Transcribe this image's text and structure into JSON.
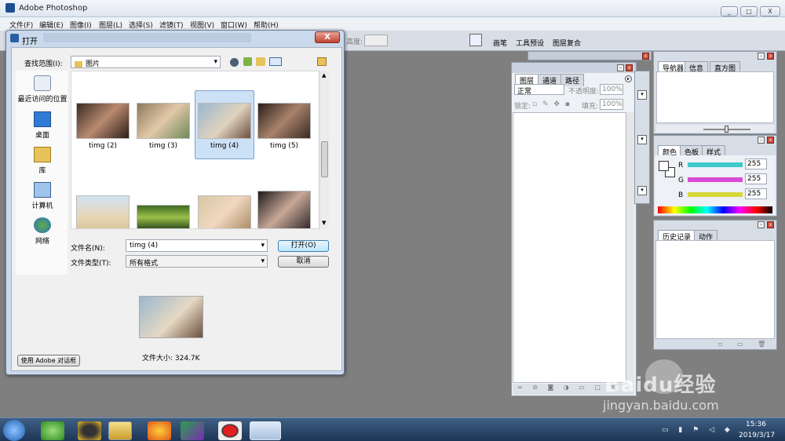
{
  "app": {
    "title": "Adobe Photoshop"
  },
  "window_controls": {
    "minimize": "_",
    "maximize": "□",
    "close": "X"
  },
  "menu": [
    "文件(F)",
    "编辑(E)",
    "图像(I)",
    "图层(L)",
    "选择(S)",
    "滤镜(T)",
    "视图(V)",
    "窗口(W)",
    "帮助(H)"
  ],
  "optionbar": {
    "height_label": "高度:",
    "tabs": [
      "画笔",
      "工具预设",
      "图层复合"
    ]
  },
  "dialog": {
    "title": "打开",
    "close": "X",
    "look_in_label": "查找范围(I):",
    "look_in_value": "图片",
    "places": [
      "最近访问的位置",
      "桌面",
      "库",
      "计算机",
      "网络"
    ],
    "files": [
      "timg (2)",
      "timg (3)",
      "timg (4)",
      "timg (5)"
    ],
    "selected_file": "timg (4)",
    "filename_label": "文件名(N):",
    "filename_value": "timg (4)",
    "filetype_label": "文件类型(T):",
    "filetype_value": "所有格式",
    "open_button": "打开(O)",
    "cancel_button": "取消",
    "file_size": "文件大小: 324.7K",
    "adobe_dialog_button": "使用 Adobe 对话框"
  },
  "layers_panel": {
    "tabs": [
      "图层",
      "通道",
      "路径"
    ],
    "blend_mode": "正常",
    "opacity_label": "不透明度:",
    "opacity_value": "100%",
    "lock_label": "锁定:",
    "fill_label": "填充:",
    "fill_value": "100%"
  },
  "navigator_panel": {
    "tabs": [
      "导航器",
      "信息",
      "直方图"
    ]
  },
  "color_panel": {
    "tabs": [
      "颜色",
      "色板",
      "样式"
    ],
    "channels": [
      {
        "name": "R",
        "value": "255",
        "color": "#3cc9c9"
      },
      {
        "name": "G",
        "value": "255",
        "color": "#d84bd6"
      },
      {
        "name": "B",
        "value": "255",
        "color": "#d6d63a"
      }
    ]
  },
  "history_panel": {
    "tabs": [
      "历史记录",
      "动作"
    ]
  },
  "taskbar": {
    "time": "15:36",
    "date": "2019/3/17"
  },
  "watermark": {
    "brand": "Baidu经验",
    "url": "jingyan.baidu.com"
  }
}
